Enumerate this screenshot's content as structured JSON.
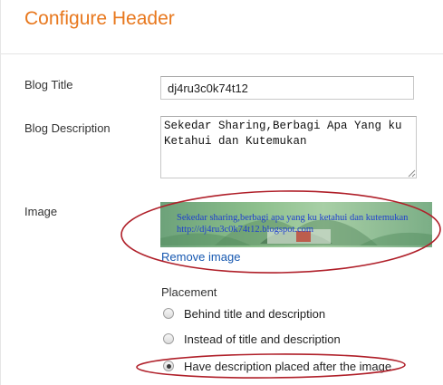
{
  "header": {
    "title": "Configure Header"
  },
  "form": {
    "blog_title_label": "Blog Title",
    "blog_title_value": "dj4ru3c0k74t12",
    "blog_description_label": "Blog Description",
    "blog_description_value": "Sekedar Sharing,Berbagi Apa Yang ku Ketahui dan Kutemukan",
    "image_label": "Image",
    "image_text_line1": "Sekedar sharing,berbagi apa yang ku ketahui dan kutemukan",
    "image_text_line2": "http://dj4ru3c0k74t12.blogspot.com",
    "remove_image_label": "Remove image",
    "placement_label": "Placement",
    "placement_options": [
      {
        "label": "Behind title and description",
        "checked": false
      },
      {
        "label": "Instead of title and description",
        "checked": false
      },
      {
        "label": "Have description placed after the image",
        "checked": true
      }
    ]
  },
  "colors": {
    "title": "#e8781e",
    "link": "#1557b0",
    "annotation": "#b0202a"
  }
}
